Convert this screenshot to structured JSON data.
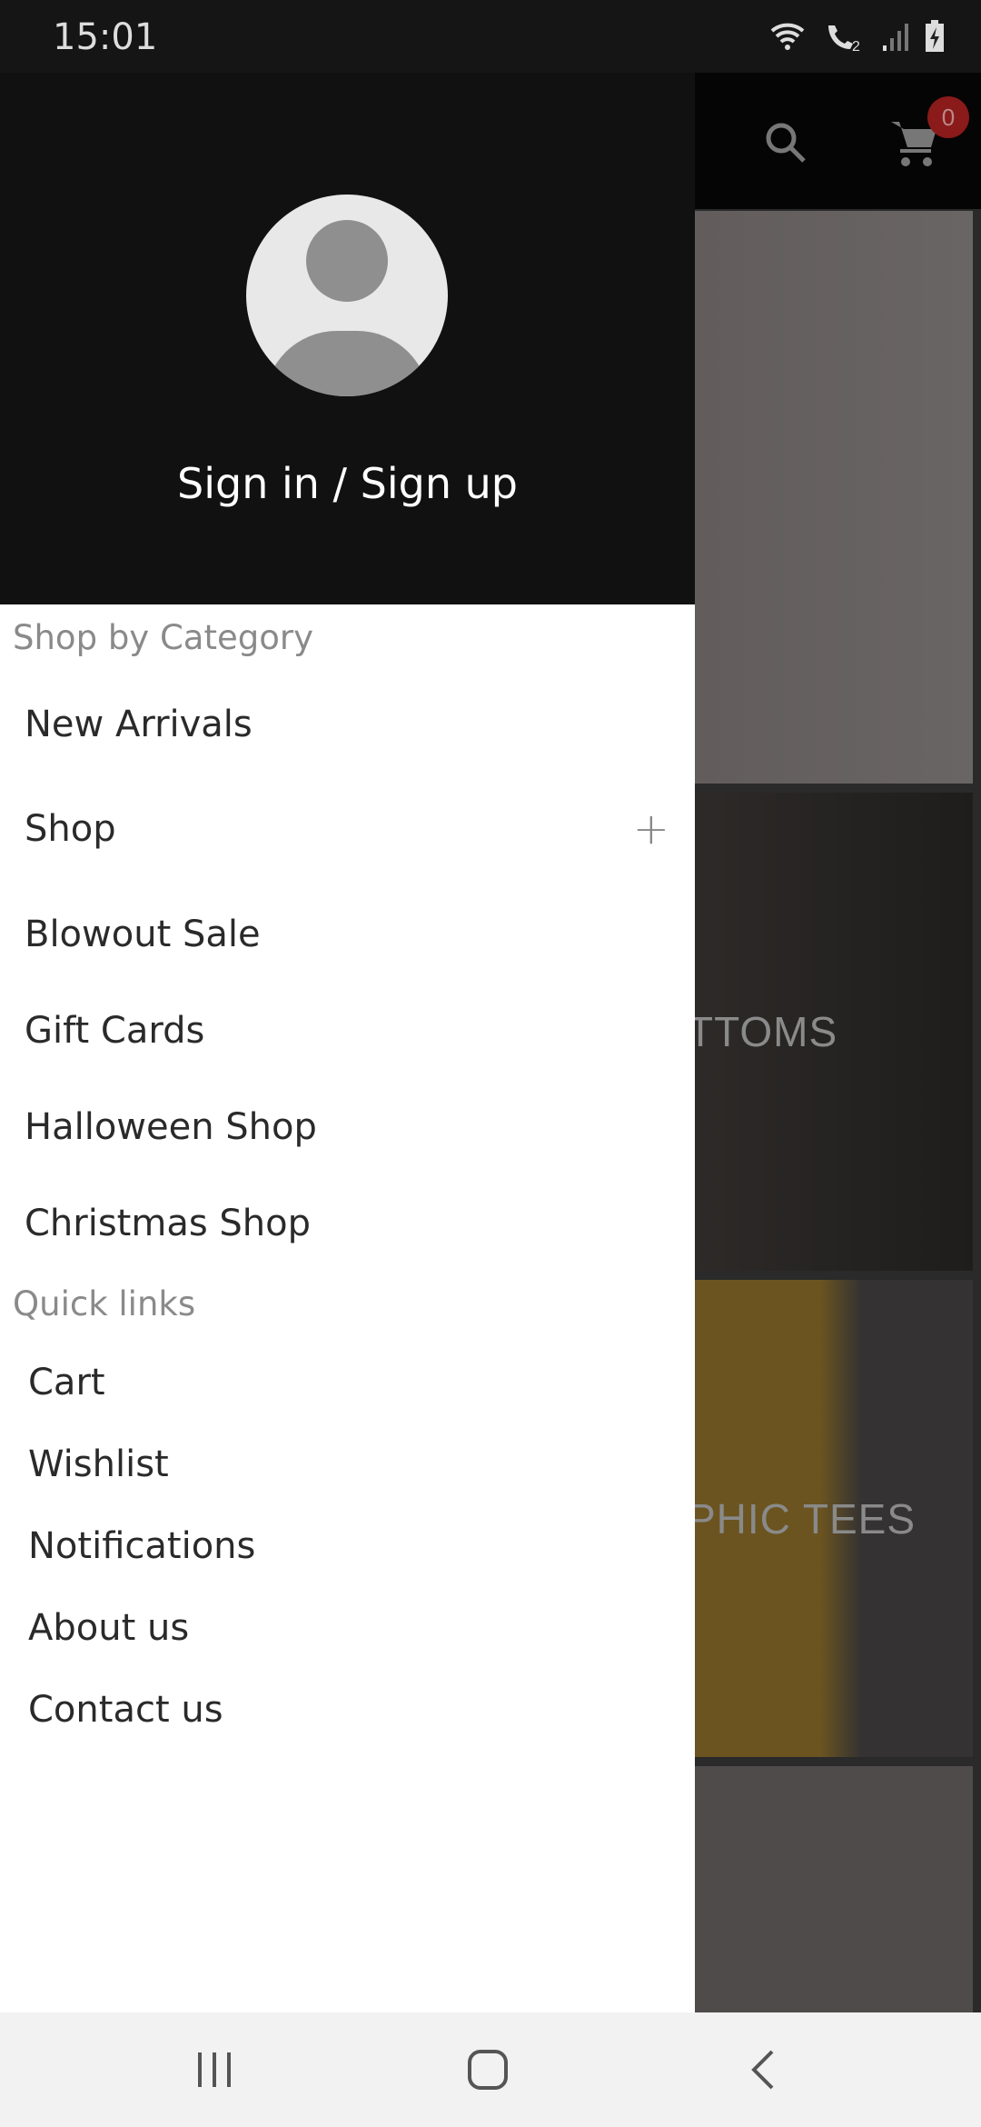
{
  "status_bar": {
    "time": "15:01",
    "icons": [
      "wifi-icon",
      "wifi-calling-icon",
      "signal-icon",
      "battery-charging-icon"
    ]
  },
  "app_bar": {
    "icons": [
      "search-icon",
      "cart-icon"
    ],
    "cart_count": "0",
    "badge_color": "#8b1a1a"
  },
  "background_tiles": [
    {
      "label": ""
    },
    {
      "label": "TTOMS"
    },
    {
      "label": "PHIC TEES"
    },
    {
      "label": ""
    }
  ],
  "drawer": {
    "sign_in": "Sign in / Sign up",
    "category_heading": "Shop by Category",
    "categories": [
      {
        "label": "New Arrivals"
      },
      {
        "label": "Shop",
        "expandable": true
      },
      {
        "label": "Blowout Sale"
      },
      {
        "label": "Gift Cards"
      },
      {
        "label": "Halloween Shop"
      },
      {
        "label": "Christmas Shop"
      }
    ],
    "quick_heading": "Quick links",
    "quick_links": [
      {
        "label": "Cart"
      },
      {
        "label": "Wishlist"
      },
      {
        "label": "Notifications"
      },
      {
        "label": "About us"
      },
      {
        "label": "Contact us"
      }
    ]
  },
  "nav_bar": {
    "buttons": [
      "recents-icon",
      "home-icon",
      "back-icon"
    ]
  }
}
